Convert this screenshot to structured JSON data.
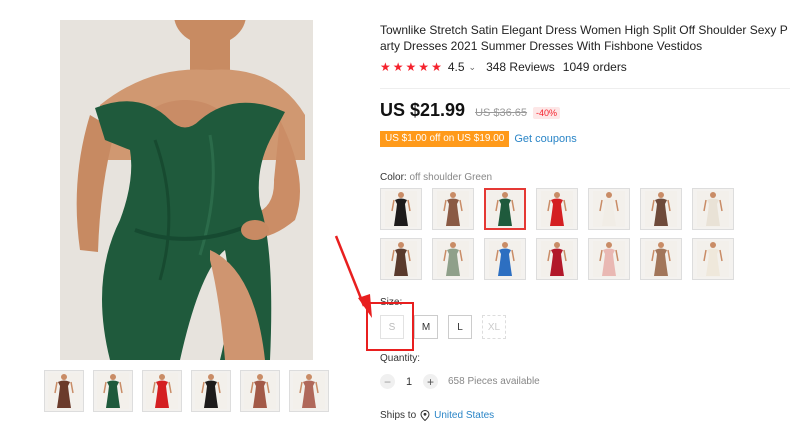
{
  "product": {
    "title": "Townlike Stretch Satin Elegant Dress Women High Split Off Shoulder Sexy Party Dresses 2021 Summer Dresses With Fishbone Vestidos",
    "rating": "4.5",
    "rating_chevron": "⌄",
    "reviews": "348 Reviews",
    "orders": "1049 orders",
    "star_count": 5,
    "star_color": "#f5222d"
  },
  "pricing": {
    "price": "US $21.99",
    "old_price": "US $36.65",
    "discount": "-40%",
    "coupon": "US $1.00 off on US $19.00",
    "get_coupons": "Get coupons",
    "coupon_color": "#ff9a1a"
  },
  "color": {
    "label": "Color:",
    "selected": "off shoulder Green",
    "swatches": [
      {
        "icon": "black-dress-thumb",
        "color": "#1d1b1b"
      },
      {
        "icon": "brown-dress-thumb",
        "color": "#8a5a44"
      },
      {
        "icon": "green-dress-thumb",
        "color": "#1f5a3c"
      },
      {
        "icon": "red-dress-thumb",
        "color": "#d41f22"
      },
      {
        "icon": "white-dress-thumb",
        "color": "#f1ede6"
      },
      {
        "icon": "mocha-dress-thumb",
        "color": "#6e4a3a"
      },
      {
        "icon": "ivory-dress-thumb",
        "color": "#e9e2d6"
      },
      {
        "icon": "chocolate-dress-thumb",
        "color": "#5a3a2c"
      },
      {
        "icon": "sage-dress-thumb",
        "color": "#8fa08a"
      },
      {
        "icon": "blue-dress-thumb",
        "color": "#2d6fc1"
      },
      {
        "icon": "wine-dress-thumb",
        "color": "#b2182a"
      },
      {
        "icon": "pink-dress-thumb",
        "color": "#e9b8b3"
      },
      {
        "icon": "camel-dress-thumb",
        "color": "#a2765a"
      },
      {
        "icon": "cream-dress-thumb",
        "color": "#efe8db"
      }
    ],
    "selected_index": 2
  },
  "size": {
    "label": "Size:",
    "options": [
      {
        "label": "S",
        "state": "s-disabled"
      },
      {
        "label": "M",
        "state": ""
      },
      {
        "label": "L",
        "state": ""
      },
      {
        "label": "XL",
        "state": "disabled"
      }
    ]
  },
  "quantity": {
    "label": "Quantity:",
    "minus": "−",
    "value": "1",
    "plus": "+",
    "available": "658 Pieces available"
  },
  "shipping": {
    "label": "Ships to",
    "destination": "United States"
  },
  "gallery": {
    "thumbnails": [
      {
        "icon": "dress-photo-thumb-1",
        "color": "#6b3b2b"
      },
      {
        "icon": "dress-photo-thumb-2",
        "color": "#1f5a3c"
      },
      {
        "icon": "dress-photo-thumb-3",
        "color": "#d41f22"
      },
      {
        "icon": "dress-photo-thumb-4",
        "color": "#1d1b1b"
      },
      {
        "icon": "dress-photo-thumb-5",
        "color": "#a35a48"
      },
      {
        "icon": "dress-photo-thumb-6",
        "color": "#b0685a"
      }
    ]
  },
  "annotation": {
    "color": "#e81f1f"
  }
}
